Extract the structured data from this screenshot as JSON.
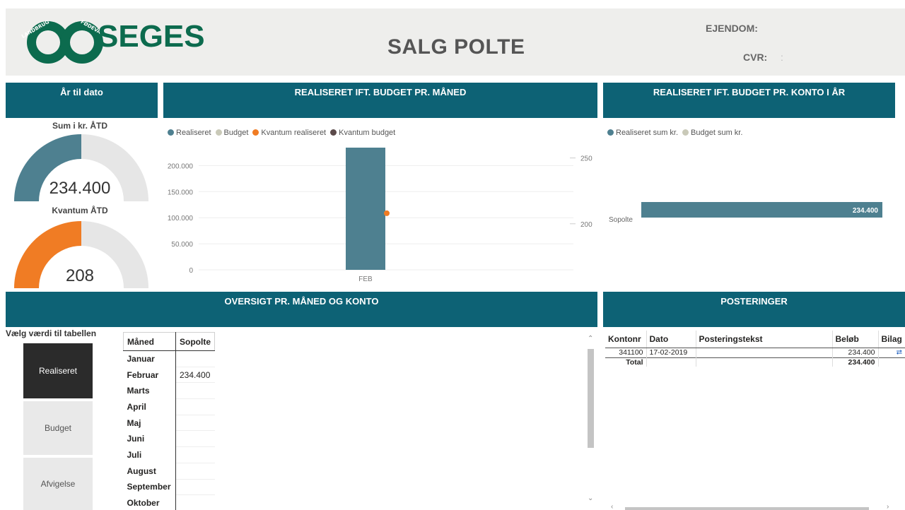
{
  "header": {
    "logo_text": "SEGES",
    "logo_ring_left": "LANDBRUG",
    "logo_ring_right": "FØDEVARER",
    "title": "SALG POLTE",
    "ejendom_label": "EJENDOM:",
    "cvr_label": "CVR:",
    "cvr_value": ":"
  },
  "colors": {
    "header_bg": "#eeeeec",
    "panel_head": "#0d6275",
    "realiseret": "#4e8090",
    "budget": "#c9c9b8",
    "kvantum_realiseret": "#f07c24",
    "kvantum_budget": "#5b4a4a",
    "logo_green": "#0c6b4e"
  },
  "ytd": {
    "title": "År til dato",
    "sum_title": "Sum i kr. ÅTD",
    "sum_value": "234.400",
    "sum_fill_fraction": 0.5,
    "kvantum_title": "Kvantum ÅTD",
    "kvantum_value": "208",
    "kvantum_fill_fraction": 0.5
  },
  "monthly": {
    "title": "REALISERET IFT. BUDGET PR. MÅNED",
    "legend": [
      "Realiseret",
      "Budget",
      "Kvantum realiseret",
      "Kvantum budget"
    ],
    "y_ticks": [
      "200.000",
      "150.000",
      "100.000",
      "50.000",
      "0"
    ],
    "y2_ticks": [
      "250",
      "200"
    ]
  },
  "chart_data": [
    {
      "type": "bar",
      "title": "REALISERET IFT. BUDGET PR. MÅNED",
      "categories": [
        "FEB"
      ],
      "series": [
        {
          "name": "Realiseret",
          "values": [
            234400
          ]
        },
        {
          "name": "Budget",
          "values": [
            0
          ]
        },
        {
          "name": "Kvantum realiseret",
          "axis": "secondary",
          "values": [
            208
          ]
        },
        {
          "name": "Kvantum budget",
          "axis": "secondary",
          "values": [
            0
          ]
        }
      ],
      "ylim": [
        0,
        234400
      ],
      "y2lim": [
        165,
        260
      ]
    },
    {
      "type": "bar",
      "orientation": "horizontal",
      "title": "REALISERET IFT. BUDGET PR. KONTO I ÅR",
      "categories": [
        "Sopolte"
      ],
      "series": [
        {
          "name": "Realiseret sum kr.",
          "values": [
            234400
          ]
        },
        {
          "name": "Budget sum kr.",
          "values": [
            0
          ]
        }
      ],
      "data_labels": [
        "234.400"
      ]
    }
  ],
  "account": {
    "title": "REALISERET IFT. BUDGET PR. KONTO I ÅR",
    "legend": [
      "Realiseret sum kr.",
      "Budget sum kr."
    ],
    "category": "Sopolte",
    "bar_label": "234.400"
  },
  "overview": {
    "title": "OVERSIGT PR. MÅNED OG KONTO",
    "slicer_title": "Vælg værdi til tabellen",
    "slicer_options": [
      "Realiseret",
      "Budget",
      "Afvigelse"
    ],
    "selected": "Realiseret",
    "col_month": "Måned",
    "col_account": "Sopolte",
    "rows": [
      {
        "month": "Januar",
        "value": ""
      },
      {
        "month": "Februar",
        "value": "234.400"
      },
      {
        "month": "Marts",
        "value": ""
      },
      {
        "month": "April",
        "value": ""
      },
      {
        "month": "Maj",
        "value": ""
      },
      {
        "month": "Juni",
        "value": ""
      },
      {
        "month": "Juli",
        "value": ""
      },
      {
        "month": "August",
        "value": ""
      },
      {
        "month": "September",
        "value": ""
      },
      {
        "month": "Oktober",
        "value": ""
      }
    ]
  },
  "postings": {
    "title": "POSTERINGER",
    "columns": [
      "Kontonr",
      "Dato",
      "Posteringstekst",
      "Beløb",
      "Bilag"
    ],
    "rows": [
      {
        "kontonr": "341100",
        "dato": "17-02-2019",
        "tekst": "",
        "belob": "234.400",
        "bilag": "link-icon"
      }
    ],
    "total_label": "Total",
    "total_value": "234.400"
  }
}
